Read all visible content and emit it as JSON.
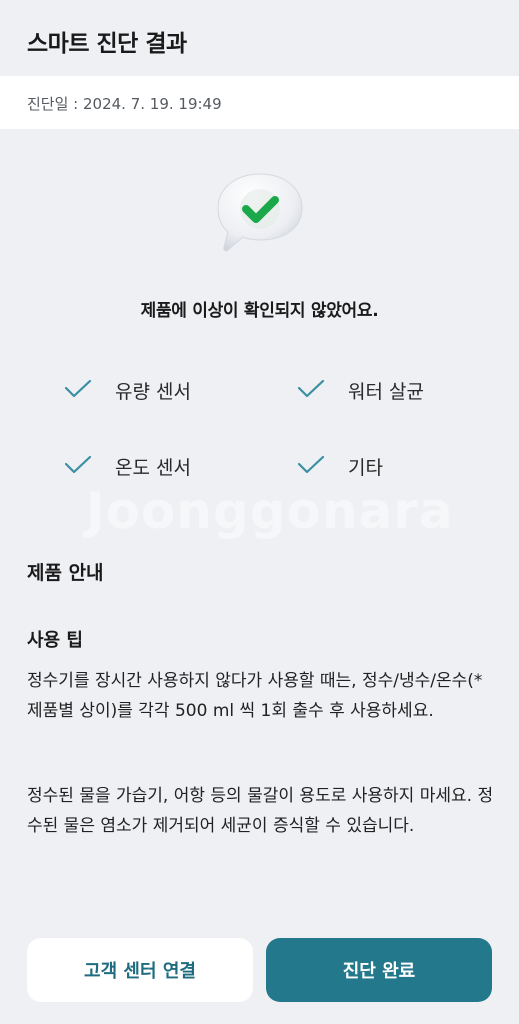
{
  "header": {
    "title": "스마트 진단 결과"
  },
  "diagnosis": {
    "date": "진단일 : 2024. 7. 19. 19:49"
  },
  "result": {
    "message": "제품에 이상이 확인되지 않았어요."
  },
  "checks": [
    {
      "label": "유량 센서"
    },
    {
      "label": "워터 살균"
    },
    {
      "label": "온도 센서"
    },
    {
      "label": "기타"
    }
  ],
  "watermark": "Joonggonara",
  "product_info": {
    "title": "제품 안내",
    "tip_title": "사용 팁",
    "tips": [
      "정수기를 장시간 사용하지 않다가 사용할 때는, 정수/냉수/온수(*제품별 상이)를 각각 500 ml 씩 1회 출수 후 사용하세요.",
      "정수된 물을 가습기, 어항 등의 물갈이 용도로 사용하지 마세요. 정수된 물은 염소가 제거되어 세균이 증식할 수 있습니다."
    ]
  },
  "buttons": {
    "contact": "고객 센터 연결",
    "complete": "진단 완료"
  },
  "colors": {
    "accent": "#24788c",
    "check": "#3a8fa3",
    "background": "#eff0f4"
  }
}
